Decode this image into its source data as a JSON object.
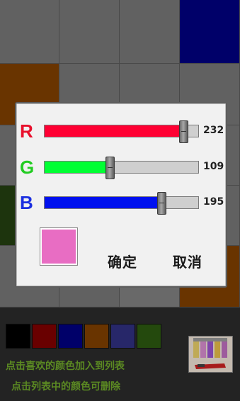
{
  "grid_colors": [
    "#777777",
    "#777777",
    "#777777",
    "#000080",
    "#804000",
    "#777777",
    "#777777",
    "#777777",
    "#777777",
    "#777777",
    "#777777",
    "#777777",
    "#244010",
    "#777777",
    "#777777",
    "#777777",
    "#777777",
    "#777777",
    "#808080",
    "#804000"
  ],
  "dialog": {
    "channels": [
      {
        "label": "R",
        "value": "232",
        "fraction": 0.9098,
        "label_color": "#e8102c",
        "fill_color": "#ff0033"
      },
      {
        "label": "G",
        "value": "109",
        "fraction": 0.4275,
        "label_color": "#22cc22",
        "fill_color": "#00ff33"
      },
      {
        "label": "B",
        "value": "195",
        "fraction": 0.7647,
        "label_color": "#1b2fe0",
        "fill_color": "#0011ee"
      }
    ],
    "preview_color": "#e86dc3",
    "ok_label": "确定",
    "cancel_label": "取消"
  },
  "saved_colors": [
    "#000000",
    "#800000",
    "#000080",
    "#804000",
    "#303080",
    "#2c5a10"
  ],
  "hints": {
    "line1": "点击喜欢的颜色加入到列表",
    "line2": "点击列表中的颜色可删除"
  }
}
